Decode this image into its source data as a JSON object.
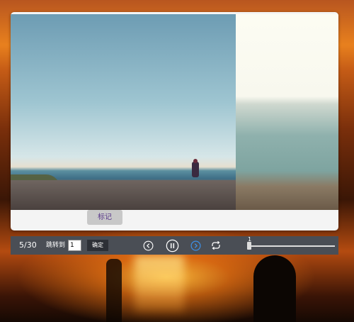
{
  "viewer": {
    "mark_button_label": "标记"
  },
  "toolbar": {
    "counter": "5/30",
    "jump_label": "跳转到",
    "jump_input_value": "1",
    "confirm_label": "确定",
    "slider_value": "1",
    "slider_fraction": 0.0
  },
  "icons": {
    "prev": "chevron-left-circle-icon",
    "pause": "pause-circle-icon",
    "next": "chevron-right-circle-icon",
    "loop": "repeat-icon"
  },
  "colors": {
    "toolbar_bg": "#4a4e55",
    "next_icon_accent": "#3d8fe6",
    "mark_button_text": "#5a3a8a"
  }
}
